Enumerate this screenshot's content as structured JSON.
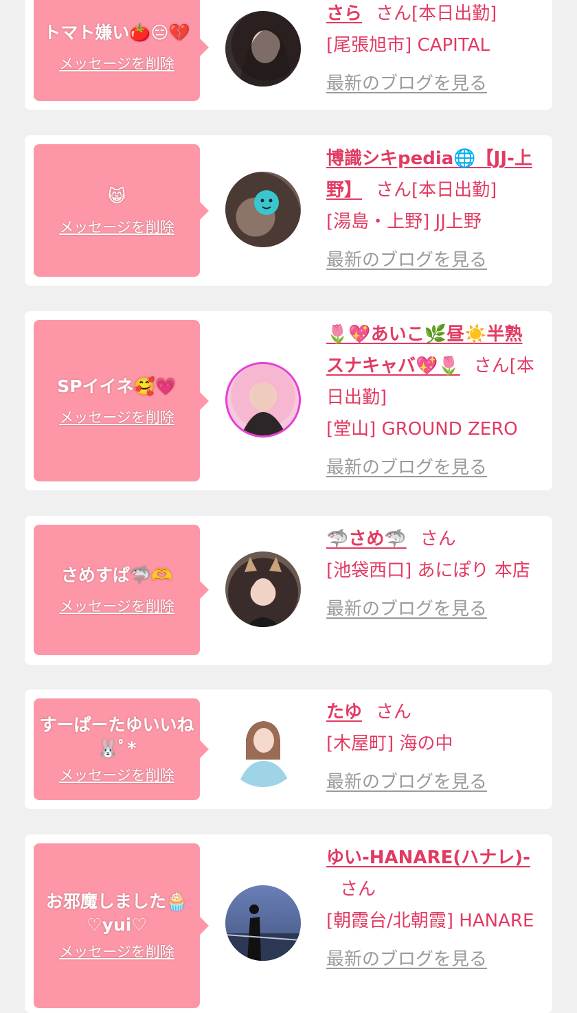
{
  "colors": {
    "bubble": "#fd97a7",
    "accent": "#e23a62",
    "muted": "#9a9a9a",
    "background": "#f0f0f0"
  },
  "cards": [
    {
      "message": "トマト嫌い🍅😑💔",
      "delete_label": "メッセージを削除",
      "name": "さら",
      "san": "さん",
      "status": "[本日出勤]",
      "area": "[尾張旭市] CAPITAL",
      "blog_label": "最新のブログを見る"
    },
    {
      "message": "😸",
      "delete_label": "メッセージを削除",
      "name": "博識シキpedia🌐【JJ-上野】",
      "san": "さん",
      "status": "[本日出勤]",
      "area": "[湯島・上野] JJ上野",
      "blog_label": "最新のブログを見る"
    },
    {
      "message": "SPイイネ🥰💗",
      "delete_label": "メッセージを削除",
      "name": "🌷💖あいこ🌿昼☀️半熟スナキャバ💖🌷",
      "san": "さん",
      "status": "[本日出勤]",
      "area": "[堂山] GROUND ZERO",
      "blog_label": "最新のブログを見る"
    },
    {
      "message": "さめすぱ🦈🫶",
      "delete_label": "メッセージを削除",
      "name": "🦈さめ🦈",
      "san": "さん",
      "status": "",
      "area": "[池袋西口] あにぽり 本店",
      "blog_label": "最新のブログを見る"
    },
    {
      "message": "すーぱーたゆいいね🐰ﾟ*",
      "delete_label": "メッセージを削除",
      "name": "たゆ",
      "san": "さん",
      "status": "",
      "area": "[木屋町] 海の中",
      "blog_label": "最新のブログを見る"
    },
    {
      "message": "お邪魔しました🧁♡yui♡",
      "delete_label": "メッセージを削除",
      "name": "ゆい-HANARE(ハナレ)-",
      "san": "さん",
      "status": "",
      "area": "[朝霞台/北朝霞] HANARE",
      "blog_label": "最新のブログを見る"
    }
  ]
}
